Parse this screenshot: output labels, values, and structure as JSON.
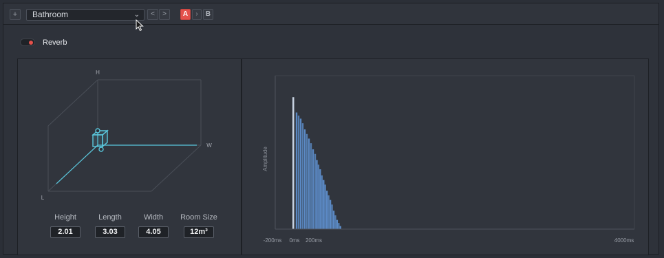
{
  "toolbar": {
    "add_icon": "plus-icon",
    "preset": "Bathroom",
    "prev_icon": "chevron-left-icon",
    "next_icon": "chevron-right-icon",
    "compare_a": "A",
    "compare_arrow": "›",
    "compare_b": "B",
    "colors": {
      "a_active": "#e4514b"
    }
  },
  "reverb": {
    "label": "Reverb",
    "enabled": true
  },
  "room": {
    "axis_h": "H",
    "axis_w": "W",
    "axis_l": "L",
    "dimensions": [
      {
        "label": "Height",
        "value": "2.01"
      },
      {
        "label": "Length",
        "value": "3.03"
      },
      {
        "label": "Width",
        "value": "4.05"
      },
      {
        "label": "Room Size",
        "value": "12m³"
      }
    ]
  },
  "chart_data": {
    "type": "bar",
    "ylabel": "Amplitude",
    "xlabel": "",
    "x_ticks": [
      "-200ms",
      "0ms",
      "200ms",
      "4000ms"
    ],
    "xlim": [
      -200,
      4000
    ],
    "ylim": [
      0,
      1
    ],
    "grid": false,
    "colors": {
      "bars": "#5b89c4",
      "direct": "#c9d4e3"
    },
    "direct_impulse": {
      "x": 0,
      "y": 0.86
    },
    "x": [
      20,
      40,
      60,
      80,
      100,
      120,
      140,
      160,
      180,
      200,
      220,
      240,
      260,
      280,
      300,
      320,
      340,
      360,
      380,
      400,
      420,
      440,
      460,
      480,
      500
    ],
    "values": [
      0.76,
      0.74,
      0.72,
      0.69,
      0.65,
      0.62,
      0.59,
      0.56,
      0.52,
      0.49,
      0.45,
      0.42,
      0.39,
      0.35,
      0.32,
      0.29,
      0.25,
      0.22,
      0.19,
      0.16,
      0.12,
      0.09,
      0.06,
      0.04,
      0.02
    ]
  }
}
